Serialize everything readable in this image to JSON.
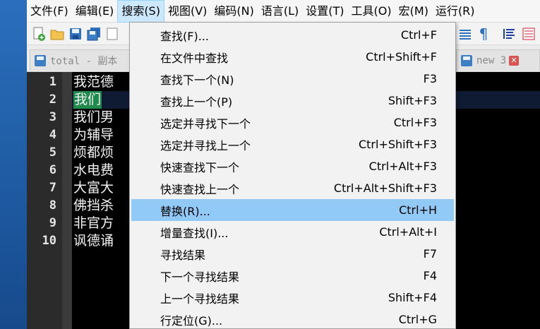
{
  "menubar": {
    "items": [
      {
        "label": "文件(F)",
        "open": false
      },
      {
        "label": "编辑(E)",
        "open": false
      },
      {
        "label": "搜索(S)",
        "open": true
      },
      {
        "label": "视图(V)",
        "open": false
      },
      {
        "label": "编码(N)",
        "open": false
      },
      {
        "label": "语言(L)",
        "open": false
      },
      {
        "label": "设置(T)",
        "open": false
      },
      {
        "label": "工具(O)",
        "open": false
      },
      {
        "label": "宏(M)",
        "open": false
      },
      {
        "label": "运行(R)",
        "open": false
      }
    ]
  },
  "toolbar": {
    "icons": [
      "new-file-icon",
      "open-folder-icon",
      "save-icon",
      "save-all-icon",
      "close-icon",
      "indent-guide-icon",
      "show-all-chars-icon",
      "wrap-icon",
      "extra-icon"
    ],
    "pilcrow": "¶"
  },
  "tabs": [
    {
      "label": "total - 副本",
      "icon": "save-icon"
    },
    {
      "label": "new 3",
      "icon": "save-icon",
      "close": "✕"
    }
  ],
  "editor": {
    "lines": [
      {
        "num": "1",
        "text": "我范德"
      },
      {
        "num": "2",
        "text": "我们"
      },
      {
        "num": "3",
        "text": "我们男"
      },
      {
        "num": "4",
        "text": "为辅导"
      },
      {
        "num": "5",
        "text": "烦都烦"
      },
      {
        "num": "6",
        "text": "水电费"
      },
      {
        "num": "7",
        "text": "大富大"
      },
      {
        "num": "8",
        "text": "佛挡杀"
      },
      {
        "num": "9",
        "text": "非官方"
      },
      {
        "num": "10",
        "text": "讽德诵"
      }
    ]
  },
  "search_menu": {
    "items": [
      {
        "label": "查找(F)...",
        "shortcut": "Ctrl+F"
      },
      {
        "label": "在文件中查找",
        "shortcut": "Ctrl+Shift+F"
      },
      {
        "label": "查找下一个(N)",
        "shortcut": "F3"
      },
      {
        "label": "查找上一个(P)",
        "shortcut": "Shift+F3"
      },
      {
        "label": "选定并寻找下一个",
        "shortcut": "Ctrl+F3"
      },
      {
        "label": "选定并寻找上一个",
        "shortcut": "Ctrl+Shift+F3"
      },
      {
        "label": "快速查找下一个",
        "shortcut": "Ctrl+Alt+F3"
      },
      {
        "label": "快速查找上一个",
        "shortcut": "Ctrl+Alt+Shift+F3"
      },
      {
        "label": "替换(R)...",
        "shortcut": "Ctrl+H",
        "active": true
      },
      {
        "label": "增量查找(I)...",
        "shortcut": "Ctrl+Alt+I"
      },
      {
        "label": "寻找结果",
        "shortcut": "F7"
      },
      {
        "label": "下一个寻找结果",
        "shortcut": "F4"
      },
      {
        "label": "上一个寻找结果",
        "shortcut": "Shift+F4"
      },
      {
        "label": "行定位(G)...",
        "shortcut": "Ctrl+G"
      }
    ]
  },
  "colors": {
    "menu_open_bg": "#cce8ff",
    "menu_active_bg": "#91c9f7",
    "selection_green": "#1f8a4c",
    "editor_bg": "#000000",
    "gutter_bg": "#2b2b2b"
  }
}
